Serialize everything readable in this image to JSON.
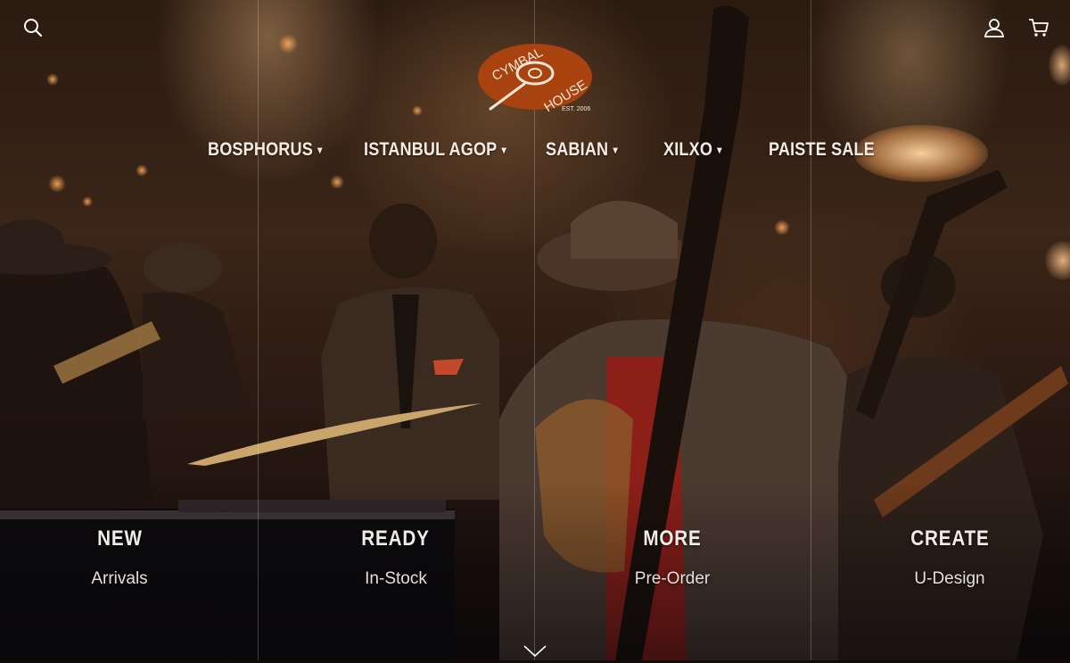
{
  "header": {
    "search_icon": "search-icon",
    "account_icon": "user-icon",
    "cart_icon": "cart-icon",
    "logo": {
      "top_text": "CYMBAL",
      "bottom_text": "HOUSE",
      "est": "EST. 2006",
      "color": "#a8420f"
    }
  },
  "nav": {
    "items": [
      {
        "label": "BOSPHORUS",
        "caret": "▾"
      },
      {
        "label": "ISTANBUL AGOP",
        "caret": "▾"
      },
      {
        "label": "SABIAN",
        "caret": "▾"
      },
      {
        "label": "XILXO",
        "caret": "▾"
      },
      {
        "label": "PAISTE SALE",
        "caret": ""
      }
    ]
  },
  "tiles": [
    {
      "title": "NEW",
      "subtitle": "Arrivals"
    },
    {
      "title": "READY",
      "subtitle": "In-Stock"
    },
    {
      "title": "MORE",
      "subtitle": "Pre-Order"
    },
    {
      "title": "CREATE",
      "subtitle": "U-Design"
    }
  ],
  "scroll_icon": "chevron-down-icon"
}
